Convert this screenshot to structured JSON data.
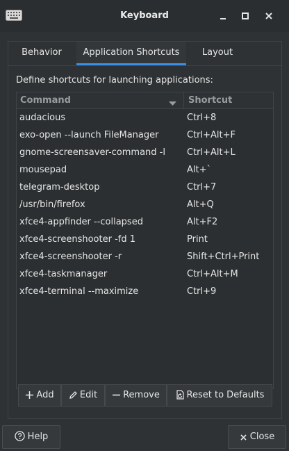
{
  "window": {
    "title": "Keyboard"
  },
  "tabs": [
    {
      "label": "Behavior"
    },
    {
      "label": "Application Shortcuts"
    },
    {
      "label": "Layout"
    }
  ],
  "description": "Define shortcuts for launching applications:",
  "table": {
    "columns": {
      "command": "Command",
      "shortcut": "Shortcut"
    },
    "rows": [
      {
        "command": "audacious",
        "shortcut": "Ctrl+8"
      },
      {
        "command": "exo-open --launch FileManager",
        "shortcut": "Ctrl+Alt+F"
      },
      {
        "command": "gnome-screensaver-command -l",
        "shortcut": "Ctrl+Alt+L"
      },
      {
        "command": "mousepad",
        "shortcut": "Alt+`"
      },
      {
        "command": "telegram-desktop",
        "shortcut": "Ctrl+7"
      },
      {
        "command": "/usr/bin/firefox",
        "shortcut": "Alt+Q"
      },
      {
        "command": "xfce4-appfinder --collapsed",
        "shortcut": "Alt+F2"
      },
      {
        "command": "xfce4-screenshooter -fd 1",
        "shortcut": "Print"
      },
      {
        "command": "xfce4-screenshooter -r",
        "shortcut": "Shift+Ctrl+Print"
      },
      {
        "command": "xfce4-taskmanager",
        "shortcut": "Ctrl+Alt+M"
      },
      {
        "command": "xfce4-terminal --maximize",
        "shortcut": "Ctrl+9"
      }
    ]
  },
  "toolbar": {
    "add": "Add",
    "edit": "Edit",
    "remove": "Remove",
    "reset": "Reset to Defaults"
  },
  "footer": {
    "help": "Help",
    "close": "Close"
  },
  "colors": {
    "accent": "#3a8ee6",
    "background": "#2f3234"
  }
}
